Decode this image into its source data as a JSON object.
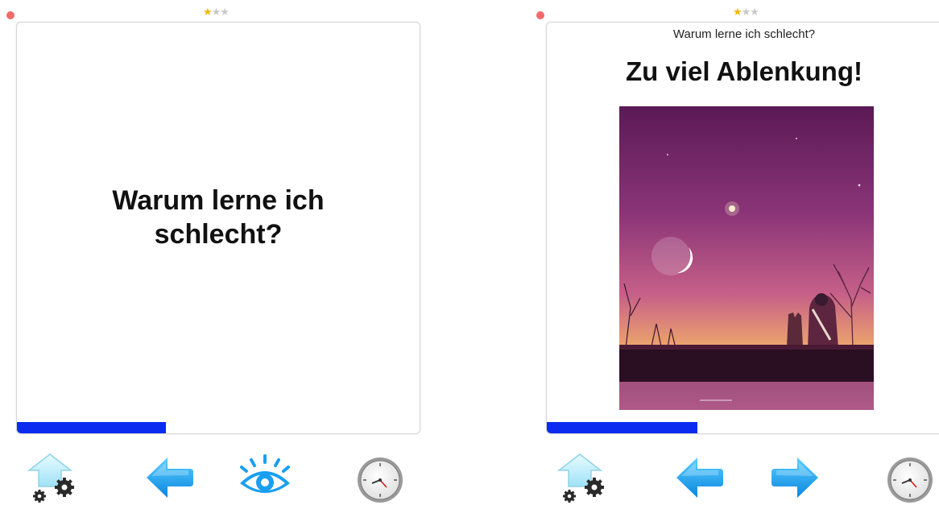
{
  "colors": {
    "progress": "#0b2cf0",
    "arrow_blue": "#1aa3f2",
    "star_active": "#f2b705",
    "star_inactive": "#c8c8c8",
    "record_dot": "#f26a6a"
  },
  "left_screen": {
    "rating": {
      "stars_filled": 1,
      "stars_total": 3,
      "symbol_on": "★",
      "symbol_off": "★★"
    },
    "card": {
      "question": "Warum lerne ich schlecht?"
    },
    "progress": {
      "fraction": 0.37
    },
    "toolbar": [
      {
        "icon": "upload-gear-icon"
      },
      {
        "icon": "arrow-left-icon"
      },
      {
        "icon": "eye-icon"
      },
      {
        "icon": "clock-icon"
      }
    ]
  },
  "right_screen": {
    "rating": {
      "stars_filled": 1,
      "stars_total": 3,
      "symbol_on": "★",
      "symbol_off": "★★"
    },
    "card": {
      "question": "Warum lerne ich schlecht?",
      "answer": "Zu viel Ablenkung!",
      "image": "dusk-sky-girl-and-cat-illustration"
    },
    "progress": {
      "fraction": 0.36
    },
    "toolbar": [
      {
        "icon": "upload-gear-icon"
      },
      {
        "icon": "arrow-left-icon"
      },
      {
        "icon": "arrow-right-icon"
      },
      {
        "icon": "clock-icon"
      }
    ]
  }
}
